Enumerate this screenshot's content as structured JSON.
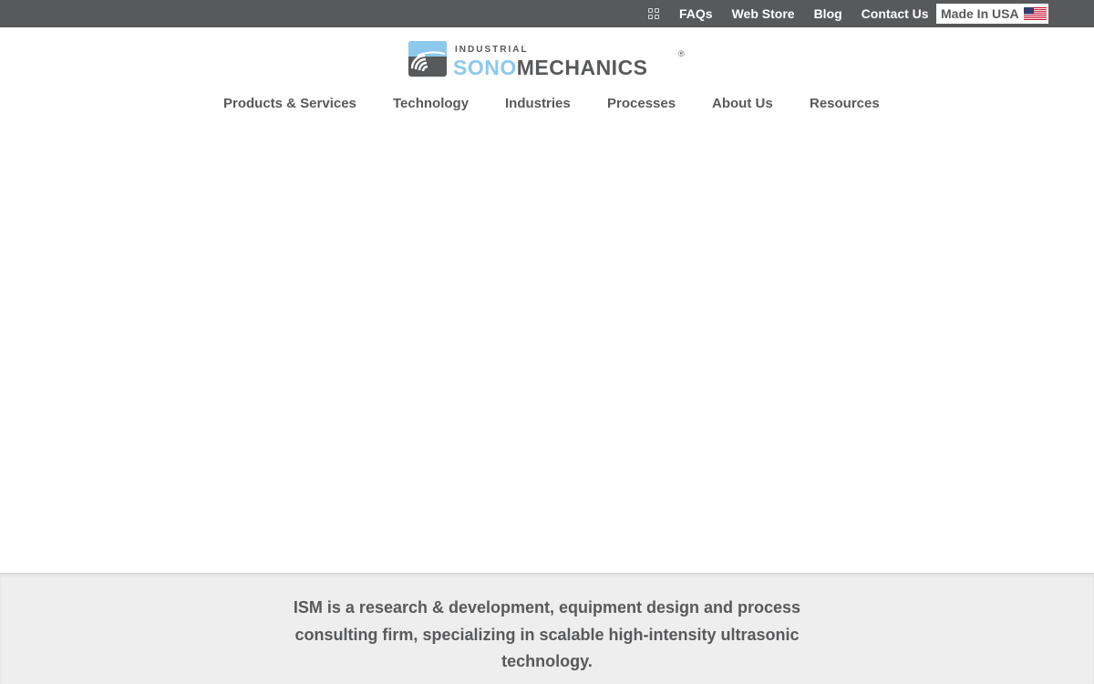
{
  "topbar": {
    "grid_icon": "grid-icon",
    "links": [
      "FAQs",
      "Web Store",
      "Blog",
      "Contact Us"
    ],
    "made_in_usa": "Made In USA",
    "flag_icon": "us-flag-icon"
  },
  "logo": {
    "small_text": "INDUSTRIAL",
    "brand_part1": "SONO",
    "brand_part2": "MECHANICS",
    "registered": "®",
    "colors": {
      "light_blue": "#8dc9ec",
      "gray": "#58595b"
    }
  },
  "nav": {
    "items": [
      "Products & Services",
      "Technology",
      "Industries",
      "Processes",
      "About Us",
      "Resources"
    ]
  },
  "band": {
    "text": "ISM is a research & development, equipment design and process consulting firm, specializing in scalable high-intensity ultrasonic technology."
  },
  "colors": {
    "topbar_bg": "#58595b",
    "band_bg": "#eeeeee",
    "text_gray": "#58595b"
  }
}
